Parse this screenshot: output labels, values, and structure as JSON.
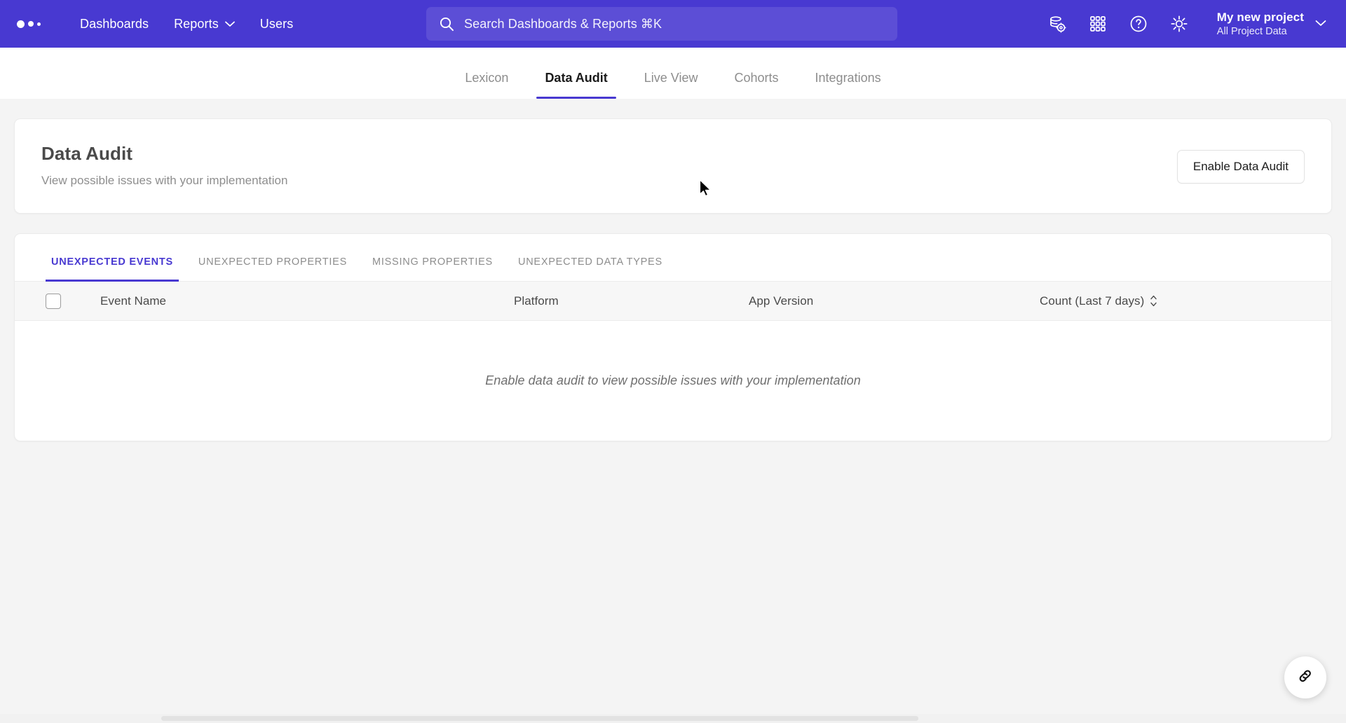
{
  "topnav": {
    "logo_icon": "mixpanel-dots-logo",
    "links": [
      {
        "label": "Dashboards",
        "caret": false
      },
      {
        "label": "Reports",
        "caret": true
      },
      {
        "label": "Users",
        "caret": false
      }
    ],
    "search": {
      "icon": "search-icon",
      "placeholder": "Search Dashboards & Reports ⌘K"
    },
    "icons": [
      {
        "name": "database-settings-icon"
      },
      {
        "name": "apps-grid-icon"
      },
      {
        "name": "help-circle-icon"
      },
      {
        "name": "settings-gear-icon"
      }
    ],
    "project": {
      "name": "My new project",
      "sub": "All Project Data",
      "caret_icon": "chevron-down-icon"
    }
  },
  "subnav": {
    "tabs": [
      {
        "label": "Lexicon",
        "active": false
      },
      {
        "label": "Data Audit",
        "active": true
      },
      {
        "label": "Live View",
        "active": false
      },
      {
        "label": "Cohorts",
        "active": false
      },
      {
        "label": "Integrations",
        "active": false
      }
    ]
  },
  "header_card": {
    "title": "Data Audit",
    "subtitle": "View possible issues with your implementation",
    "enable_button": "Enable Data Audit"
  },
  "table_card": {
    "tabs": [
      {
        "label": "Unexpected Events",
        "active": true
      },
      {
        "label": "Unexpected Properties",
        "active": false
      },
      {
        "label": "Missing Properties",
        "active": false
      },
      {
        "label": "Unexpected Data Types",
        "active": false
      }
    ],
    "columns": {
      "select_all_checkbox": "",
      "event_name": "Event Name",
      "platform": "Platform",
      "app_version": "App Version",
      "count": "Count (Last 7 days)",
      "sort_icon": "sort-updown-icon"
    },
    "rows": [],
    "empty_message": "Enable data audit to view possible issues with your implementation"
  },
  "floating": {
    "link_button_icon": "link-chain-icon"
  },
  "colors": {
    "brand_purple": "#4839d1",
    "page_background": "#f4f4f4",
    "card_background": "#ffffff",
    "muted_text": "#8d8d8d"
  }
}
